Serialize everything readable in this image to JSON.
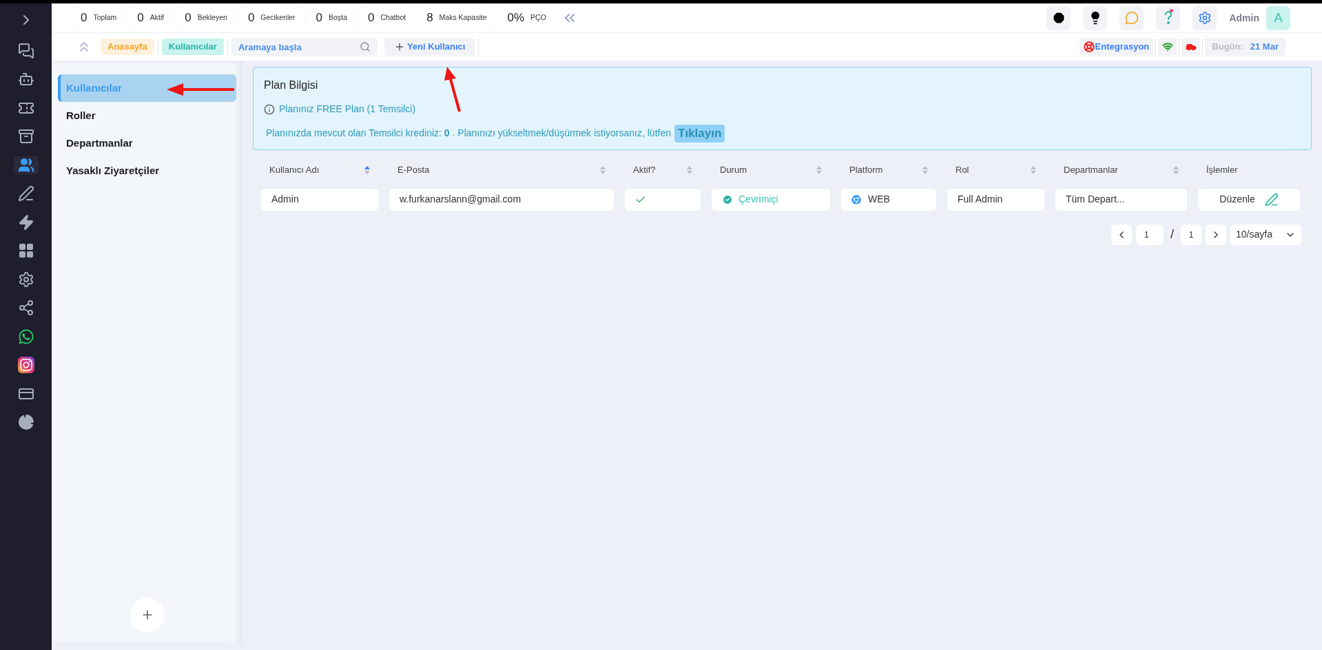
{
  "stats": [
    {
      "value": "0",
      "label": "Toplam"
    },
    {
      "value": "0",
      "label": "Aktif"
    },
    {
      "value": "0",
      "label": "Bekleyen"
    },
    {
      "value": "0",
      "label": "Gecikenler"
    },
    {
      "value": "0",
      "label": "Boşta"
    },
    {
      "value": "0",
      "label": "Chatbot"
    },
    {
      "value": "8",
      "label": "Maks Kapasite"
    },
    {
      "value": "0%",
      "label": "PÇO"
    }
  ],
  "header_buttons": [
    {
      "badge": false
    },
    {
      "badge": false
    },
    {
      "badge": false
    },
    {
      "badge": true
    },
    {
      "badge": false
    }
  ],
  "user": {
    "name": "Admin",
    "avatar": "A"
  },
  "breadcrumbs": [
    {
      "label": "Anasayfa",
      "kind": "home"
    },
    {
      "label": "Kullanıcılar",
      "kind": "current"
    }
  ],
  "search": {
    "placeholder": "Aramaya başla"
  },
  "new_user_button": "Yeni Kullanıcı",
  "status_bar": {
    "integration": "Entegrasyon",
    "date_label": "Bugün:",
    "date": "21 Mar"
  },
  "rail": [
    {
      "selected": false
    },
    {
      "selected": false
    },
    {
      "selected": false
    },
    {
      "selected": false
    },
    {
      "selected": true
    },
    {
      "selected": false
    },
    {
      "selected": false
    },
    {
      "selected": false
    },
    {
      "selected": false
    },
    {
      "selected": false
    },
    {
      "selected": false
    },
    {
      "selected": false
    },
    {
      "selected": false
    },
    {
      "selected": false
    }
  ],
  "sidebar": {
    "items": [
      {
        "label": "Kullanıcılar",
        "selected": true
      },
      {
        "label": "Roller",
        "selected": false
      },
      {
        "label": "Departmanlar",
        "selected": false
      },
      {
        "label": "Yasaklı Ziyaretçiler",
        "selected": false
      }
    ]
  },
  "plan": {
    "title": "Plan Bilgisi",
    "plan_text": "Planınız FREE Plan (1 Temsilci)",
    "credit_text": "Planınızda mevcut olan Temsilci krediniz: **0** . Planınızı yükseltmek/düşürmek istiyorsanız, lütfen",
    "link": "Tıklayın"
  },
  "table": {
    "columns": [
      {
        "label": "Kullanıcı Adı",
        "sort_ascending": true
      },
      {
        "label": "E-Posta",
        "sort_ascending": false
      },
      {
        "label": "Aktif?",
        "sort_ascending": false
      },
      {
        "label": "Durum",
        "sort_ascending": false
      },
      {
        "label": "Platform",
        "sort_ascending": false
      },
      {
        "label": "Rol",
        "sort_ascending": false
      },
      {
        "label": "Departmanlar",
        "sort_ascending": false
      },
      {
        "label": "İşlemler"
      }
    ],
    "rows": [
      {
        "username": "Admin",
        "email": "w.furkanarslann@gmail.com",
        "active": true,
        "status": {
          "label": "Çevrimiçi",
          "online": true
        },
        "platform": "WEB",
        "role": "Full Admin",
        "departments": "Tüm Depart...",
        "action": "Düzenle"
      }
    ]
  },
  "pagination": {
    "page": "1",
    "separator": "/",
    "total": "1",
    "page_size": "10/sayfa"
  }
}
